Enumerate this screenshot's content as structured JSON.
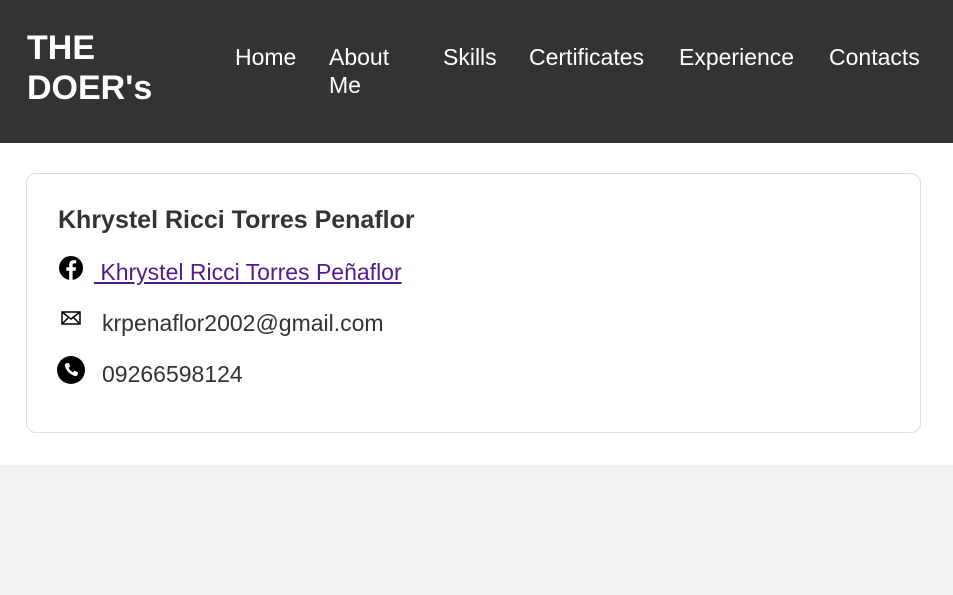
{
  "header": {
    "logo": "THE DOER's",
    "nav": {
      "home": "Home",
      "about": "About Me",
      "skills": "Skills",
      "certificates": "Certificates",
      "experience": "Experience",
      "contacts": "Contacts"
    }
  },
  "contact_card": {
    "name": "Khrystel Ricci Torres Penaflor",
    "facebook": {
      "icon": "facebook-icon",
      "label": " Khrystel Ricci Torres Peñaflor"
    },
    "email": {
      "icon": "mail-icon",
      "value": "krpenaflor2002@gmail.com"
    },
    "phone": {
      "icon": "phone-icon",
      "value": "09266598124"
    }
  },
  "colors": {
    "header_bg": "#333333",
    "link_visited": "#551a8b",
    "page_bg": "#f2f2f2"
  }
}
